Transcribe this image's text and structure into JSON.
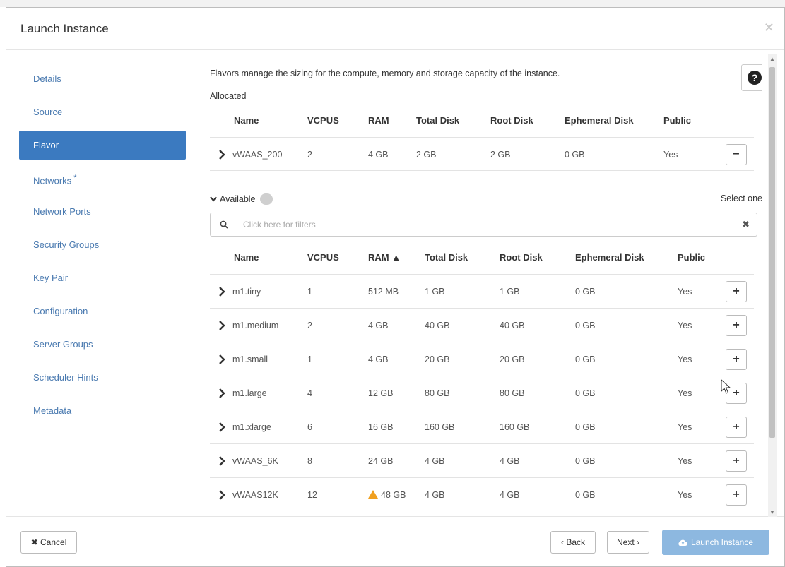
{
  "dialog": {
    "title": "Launch Instance",
    "close_glyph": "✕"
  },
  "sidebar": {
    "items": [
      {
        "label": "Details"
      },
      {
        "label": "Source"
      },
      {
        "label": "Flavor"
      },
      {
        "label": "Networks",
        "required": "*"
      },
      {
        "label": "Network Ports"
      },
      {
        "label": "Security Groups"
      },
      {
        "label": "Key Pair"
      },
      {
        "label": "Configuration"
      },
      {
        "label": "Server Groups"
      },
      {
        "label": "Scheduler Hints"
      },
      {
        "label": "Metadata"
      }
    ],
    "active_index": 2
  },
  "flavor": {
    "description": "Flavors manage the sizing for the compute, memory and storage capacity of the instance.",
    "help_glyph": "?",
    "allocated": {
      "label": "Allocated",
      "columns": [
        "Name",
        "VCPUS",
        "RAM",
        "Total Disk",
        "Root Disk",
        "Ephemeral Disk",
        "Public"
      ],
      "rows": [
        {
          "name": "vWAAS_200",
          "vcpus": "2",
          "ram": "4 GB",
          "total_disk": "2 GB",
          "root_disk": "2 GB",
          "ephemeral_disk": "0 GB",
          "public": "Yes",
          "action": "−"
        }
      ]
    },
    "available": {
      "label": "Available",
      "badge": "",
      "select_hint": "Select one",
      "filter_placeholder": "Click here for filters",
      "clear_glyph": "✖",
      "columns": [
        "Name",
        "VCPUS",
        "RAM ▲",
        "Total Disk",
        "Root Disk",
        "Ephemeral Disk",
        "Public"
      ],
      "rows": [
        {
          "name": "m1.tiny",
          "vcpus": "1",
          "ram": "512 MB",
          "total_disk": "1 GB",
          "root_disk": "1 GB",
          "ephemeral_disk": "0 GB",
          "public": "Yes",
          "action": "+"
        },
        {
          "name": "m1.medium",
          "vcpus": "2",
          "ram": "4 GB",
          "total_disk": "40 GB",
          "root_disk": "40 GB",
          "ephemeral_disk": "0 GB",
          "public": "Yes",
          "action": "+"
        },
        {
          "name": "m1.small",
          "vcpus": "1",
          "ram": "4 GB",
          "total_disk": "20 GB",
          "root_disk": "20 GB",
          "ephemeral_disk": "0 GB",
          "public": "Yes",
          "action": "+"
        },
        {
          "name": "m1.large",
          "vcpus": "4",
          "ram": "12 GB",
          "total_disk": "80 GB",
          "root_disk": "80 GB",
          "ephemeral_disk": "0 GB",
          "public": "Yes",
          "action": "+"
        },
        {
          "name": "m1.xlarge",
          "vcpus": "6",
          "ram": "16 GB",
          "total_disk": "160 GB",
          "root_disk": "160 GB",
          "ephemeral_disk": "0 GB",
          "public": "Yes",
          "action": "+"
        },
        {
          "name": "vWAAS_6K",
          "vcpus": "8",
          "ram": "24 GB",
          "total_disk": "4 GB",
          "root_disk": "4 GB",
          "ephemeral_disk": "0 GB",
          "public": "Yes",
          "action": "+"
        },
        {
          "name": "vWAAS12K",
          "vcpus": "12",
          "ram": "48 GB",
          "ram_warning": true,
          "total_disk": "4 GB",
          "root_disk": "4 GB",
          "ephemeral_disk": "0 GB",
          "public": "Yes",
          "action": "+"
        }
      ]
    }
  },
  "footer": {
    "cancel_label": "✖ Cancel",
    "back_label": "‹ Back",
    "next_label": "Next ›",
    "launch_label": "Launch Instance"
  },
  "colors": {
    "accent": "#3b7ac0",
    "link": "#4a7ab0",
    "launch_disabled": "#8db8e0",
    "warning": "#f0a020"
  },
  "icons": {
    "help": "question-circle-icon",
    "search": "search-icon",
    "clear": "times-icon",
    "expand": "chevron-right-icon",
    "warning": "warning-triangle-icon",
    "launch": "cloud-upload-icon"
  }
}
